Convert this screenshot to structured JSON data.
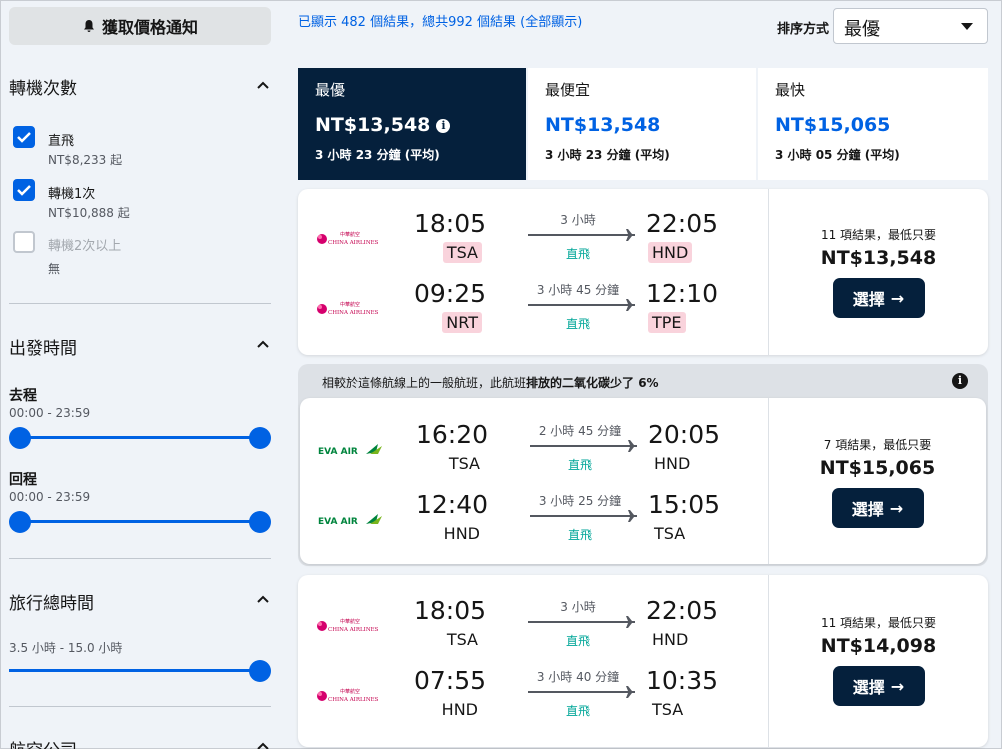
{
  "sidebar": {
    "alert_label": "獲取價格通知",
    "stops": {
      "title": "轉機次數",
      "options": [
        {
          "label": "直飛",
          "sub": "NT$8,233 起"
        },
        {
          "label": "轉機1次",
          "sub": "NT$10,888 起"
        },
        {
          "label": "轉機2次以上",
          "sub": "無"
        }
      ]
    },
    "departure": {
      "title": "出發時間",
      "outbound_label": "去程",
      "outbound_range": "00:00 - 23:59",
      "return_label": "回程",
      "return_range": "00:00 - 23:59"
    },
    "duration": {
      "title": "旅行總時間",
      "range": "3.5 小時 - 15.0 小時"
    },
    "airlines": {
      "title": "航空公司"
    }
  },
  "header": {
    "result_text": "已顯示 482 個結果，總共992 個結果 (全部顯示)",
    "sort_label": "排序方式",
    "sort_value": "最優"
  },
  "tabs": [
    {
      "label": "最優",
      "price": "NT$13,548",
      "duration": "3 小時 23 分鐘 (平均)"
    },
    {
      "label": "最便宜",
      "price": "NT$13,548",
      "duration": "3 小時 23 分鐘 (平均)"
    },
    {
      "label": "最快",
      "price": "NT$15,065",
      "duration": "3 小時 05 分鐘 (平均)"
    }
  ],
  "eco_banner": {
    "prefix": "相較於這條航線上的一般航班，此航班",
    "bold": "排放的二氧化碳少了 6%"
  },
  "cards": [
    {
      "legs": [
        {
          "airline": "CHINA AIRLINES",
          "dep": "18:05",
          "dep_code": "TSA",
          "arr": "22:05",
          "arr_code": "HND",
          "duration": "3 小時",
          "stops": "直飛"
        },
        {
          "airline": "CHINA AIRLINES",
          "dep": "09:25",
          "dep_code": "NRT",
          "arr": "12:10",
          "arr_code": "TPE",
          "duration": "3 小時 45 分鐘",
          "stops": "直飛"
        }
      ],
      "deals": "11 項結果，最低只要",
      "price": "NT$13,548",
      "select": "選擇"
    },
    {
      "legs": [
        {
          "airline": "EVA AIR",
          "dep": "16:20",
          "dep_code": "TSA",
          "arr": "20:05",
          "arr_code": "HND",
          "duration": "2 小時 45 分鐘",
          "stops": "直飛"
        },
        {
          "airline": "EVA AIR",
          "dep": "12:40",
          "dep_code": "HND",
          "arr": "15:05",
          "arr_code": "TSA",
          "duration": "3 小時 25 分鐘",
          "stops": "直飛"
        }
      ],
      "deals": "7 項結果，最低只要",
      "price": "NT$15,065",
      "select": "選擇"
    },
    {
      "legs": [
        {
          "airline": "CHINA AIRLINES",
          "dep": "18:05",
          "dep_code": "TSA",
          "arr": "22:05",
          "arr_code": "HND",
          "duration": "3 小時",
          "stops": "直飛"
        },
        {
          "airline": "CHINA AIRLINES",
          "dep": "07:55",
          "dep_code": "HND",
          "arr": "10:35",
          "arr_code": "TSA",
          "duration": "3 小時 40 分鐘",
          "stops": "直飛"
        }
      ],
      "deals": "11 項結果，最低只要",
      "price": "NT$14,098",
      "select": "選擇"
    }
  ],
  "colors": {
    "accent": "#0062e3",
    "navy": "#05203c",
    "direct": "#00a698",
    "highlight": "#f9d3dc"
  }
}
